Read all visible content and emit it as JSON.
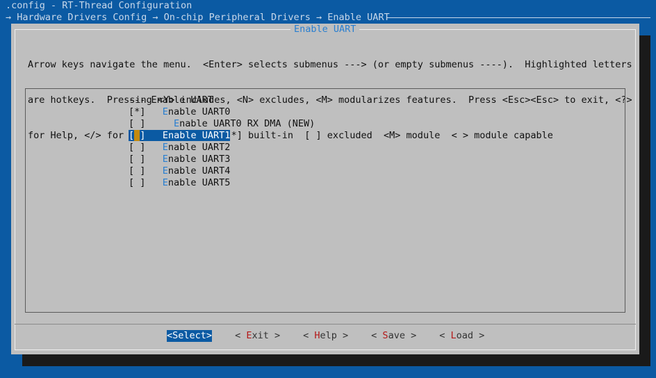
{
  "window": {
    "title": ".config - RT-Thread Configuration",
    "breadcrumb": "→ Hardware Drivers Config → On-chip Peripheral Drivers → Enable UART"
  },
  "dialog": {
    "title": "Enable UART",
    "help_lines": [
      "Arrow keys navigate the menu.  <Enter> selects submenus ---> (or empty submenus ----).  Highlighted letters",
      "are hotkeys.  Pressing <Y> includes, <N> excludes, <M> modularizes features.  Press <Esc><Esc> to exit, <?>",
      "for Help, </> for Search.  Legend: [*] built-in  [ ] excluded  <M> module  < > module capable"
    ]
  },
  "menu": {
    "header": "--- Enable UART",
    "items": [
      {
        "check": "[*]",
        "indent": "   ",
        "hotkey": "E",
        "rest": "nable UART0",
        "selected": false
      },
      {
        "check": "[ ]",
        "indent": "     ",
        "hotkey": "E",
        "rest": "nable UART0 RX DMA (NEW)",
        "selected": false
      },
      {
        "check": "[ ]",
        "indent": "   ",
        "hotkey": "E",
        "rest": "nable UART1",
        "selected": true
      },
      {
        "check": "[ ]",
        "indent": "   ",
        "hotkey": "E",
        "rest": "nable UART2",
        "selected": false
      },
      {
        "check": "[ ]",
        "indent": "   ",
        "hotkey": "E",
        "rest": "nable UART3",
        "selected": false
      },
      {
        "check": "[ ]",
        "indent": "   ",
        "hotkey": "E",
        "rest": "nable UART4",
        "selected": false
      },
      {
        "check": "[ ]",
        "indent": "   ",
        "hotkey": "E",
        "rest": "nable UART5",
        "selected": false
      }
    ]
  },
  "buttons": [
    {
      "pre": "<",
      "hotkey": "S",
      "rest": "elect>",
      "active": true
    },
    {
      "pre": "< ",
      "hotkey": "E",
      "rest": "xit >",
      "active": false
    },
    {
      "pre": "< ",
      "hotkey": "H",
      "rest": "elp >",
      "active": false
    },
    {
      "pre": "< ",
      "hotkey": "S",
      "rest": "ave >",
      "active": false
    },
    {
      "pre": "< ",
      "hotkey": "L",
      "rest": "oad >",
      "active": false
    }
  ],
  "colors": {
    "background": "#0b5aa3",
    "dialog": "#bfbfbf",
    "hotkey_blue": "#2a7fd0",
    "hotkey_red": "#b31818",
    "cursor": "#c28a10"
  }
}
